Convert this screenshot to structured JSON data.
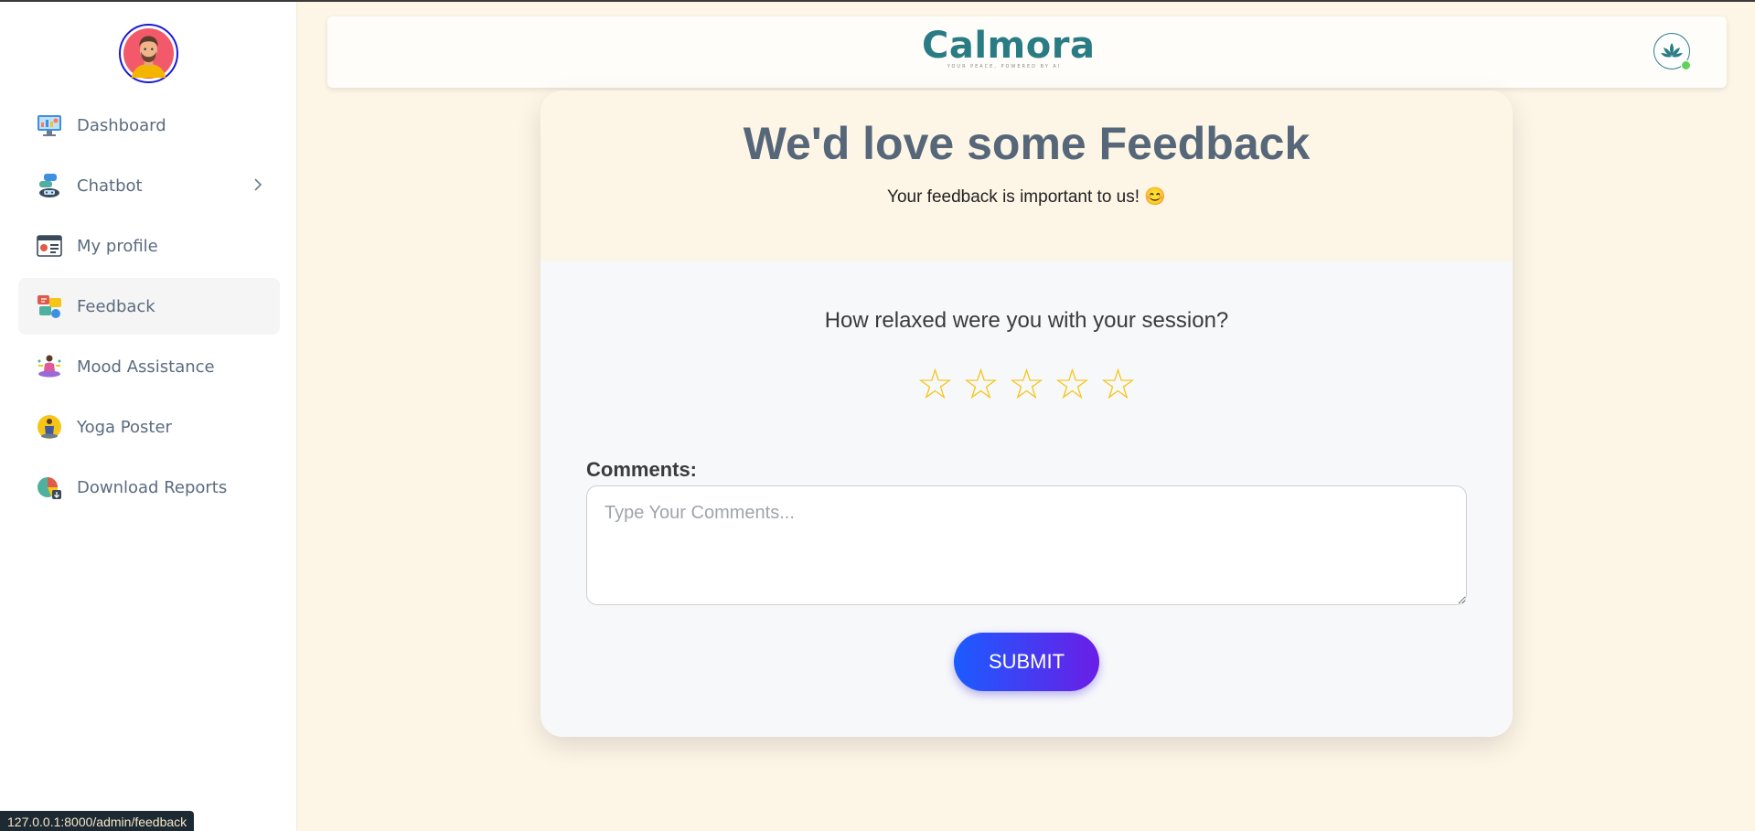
{
  "sidebar": {
    "items": [
      {
        "label": "Dashboard",
        "icon": "monitor-dashboard-icon"
      },
      {
        "label": "Chatbot",
        "icon": "chatbot-icon"
      },
      {
        "label": "My profile",
        "icon": "profile-card-icon"
      },
      {
        "label": "Feedback",
        "icon": "feedback-icon"
      },
      {
        "label": "Mood Assistance",
        "icon": "meditation-icon"
      },
      {
        "label": "Yoga Poster",
        "icon": "yoga-icon"
      },
      {
        "label": "Download Reports",
        "icon": "reports-chart-icon"
      }
    ],
    "active": "Feedback"
  },
  "header": {
    "brand": "Calmora",
    "tagline": "YOUR PEACE, POWERED BY AI"
  },
  "feedback": {
    "title": "We'd love some Feedback",
    "subtitle": "Your feedback is important to us! 😊",
    "question": "How relaxed were you with your session?",
    "star": "☆",
    "rating": 0,
    "max_rating": 5,
    "comments_label": "Comments:",
    "comments_placeholder": "Type Your Comments...",
    "comments_value": "",
    "submit_label": "SUBMIT"
  },
  "status_bar": {
    "url": "127.0.0.1:8000/admin/feedback"
  },
  "colors": {
    "background": "#fdf5e6",
    "brand": "#2a7c84",
    "star": "#f5c518",
    "button_start": "#1a5cff",
    "button_end": "#6b1ee6",
    "avatar_ring": "#1a1ad6"
  }
}
